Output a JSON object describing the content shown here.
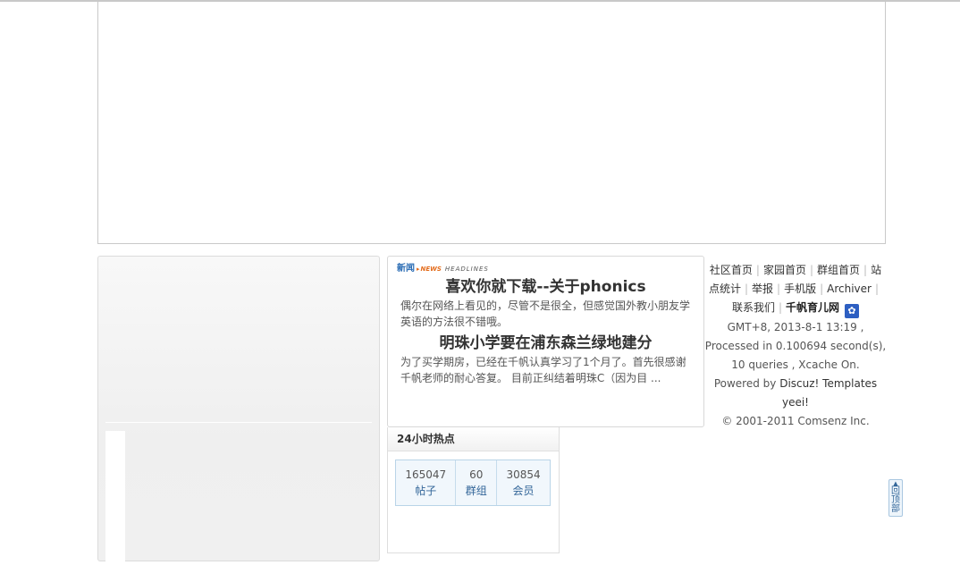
{
  "news": {
    "logo_cn": "新闻",
    "logo_en": "NEWS",
    "logo_headlines": "HEADLINES",
    "items": [
      {
        "title": "喜欢你就下载--关于phonics",
        "summary": "偶尔在网络上看见的，尽管不是很全，但感觉国外教小朋友学英语的方法很不错哦。"
      },
      {
        "title": "明珠小学要在浦东森兰绿地建分",
        "summary": "为了买学期房，已经在千帆认真学习了1个月了。首先很感谢千帆老师的耐心答复。 目前正纠结着明珠C（因为目 ..."
      }
    ]
  },
  "hot": {
    "title": "24小时热点",
    "stats": [
      {
        "value": "165047",
        "label": "帖子"
      },
      {
        "value": "60",
        "label": "群组"
      },
      {
        "value": "30854",
        "label": "会员"
      }
    ]
  },
  "footer": {
    "links": [
      "社区首页",
      "家园首页",
      "群组首页",
      "站点统计",
      "举报",
      "手机版",
      "Archiver",
      "联系我们"
    ],
    "site_name": "千帆育儿网",
    "badge_icon": "paw-icon",
    "time_line": "GMT+8, 2013-8-1 13:19 , Processed in 0.100694 second(s), 10 queries , Xcache On.",
    "powered_prefix": "Powered by",
    "powered_discuz": "Discuz!",
    "powered_templates": "Templates yeei!",
    "copyright": "© 2001-2011 Comsenz Inc."
  },
  "back_to_top": {
    "label": "回顶部",
    "icon": "up-arrow-icon"
  },
  "colors": {
    "accent_blue": "#336699",
    "news_orange": "#e36b1a",
    "badge_blue": "#2d5fc2"
  }
}
